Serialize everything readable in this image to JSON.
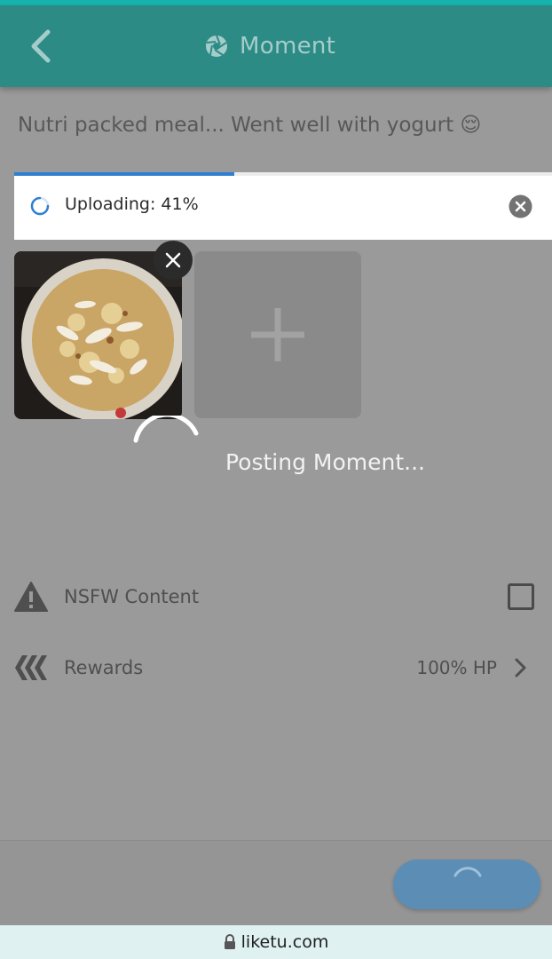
{
  "header": {
    "title": "Moment",
    "back_icon": "chevron-left-icon",
    "app_icon": "aperture-icon"
  },
  "caption": "Nutri packed meal... Went well with yogurt 😌",
  "upload": {
    "label": "Uploading: 41%",
    "progress": 0.41
  },
  "posting_overlay": {
    "text": "Posting Moment..."
  },
  "options": {
    "nsfw": {
      "label": "NSFW Content",
      "checked": false
    },
    "rewards": {
      "label": "Rewards",
      "value": "100% HP"
    }
  },
  "browser": {
    "url": "liketu.com"
  },
  "colors": {
    "header": "#2d8b86",
    "accent": "#2f7fd1",
    "post_button": "#5b8db5"
  }
}
